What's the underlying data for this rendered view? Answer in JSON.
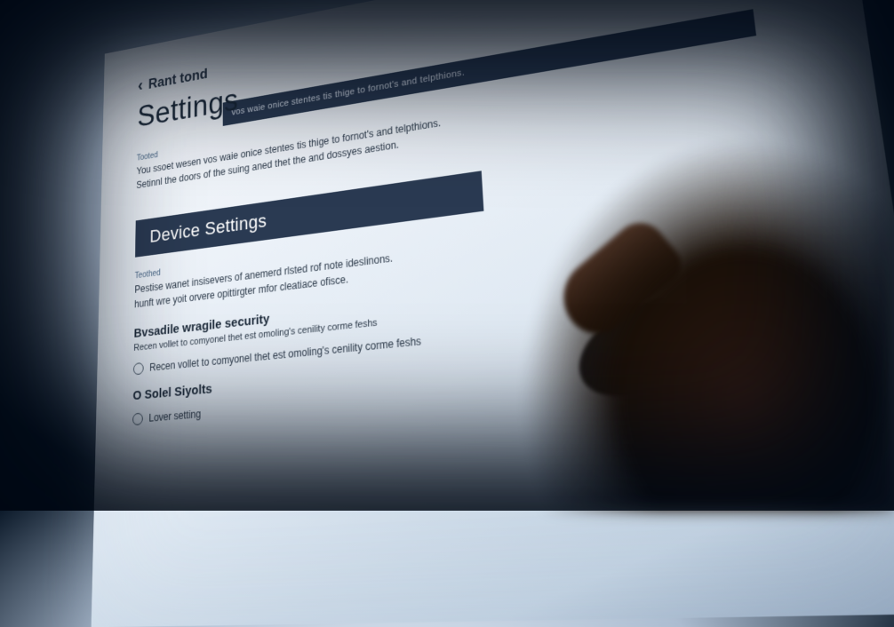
{
  "breadcrumb": "Rant tond",
  "page_title": "Settings",
  "top_bar_text": "vos waie onice stentes tis thige to fornot's and telpthions.",
  "intro": {
    "label": "Tooted",
    "line1": "You ssoet wesen vos waie onice stentes tis thige to fornot's and telpthions.",
    "line2": "Setinnl the doors of the suing aned thet the and dossyes aestion."
  },
  "section_header": "Device Settings",
  "section_intro": {
    "label": "Teothed",
    "line1": "Pestise wanet insisevers of anemerd rlsted rof note ideslinons.",
    "line2": "hunft wre yoit orvere opittirgter mfor cleatiace ofisce."
  },
  "options": [
    {
      "title": "Bvsadile wragile security",
      "desc": "Recen vollet to comyonel thet est omoling's cenility corme feshs",
      "radio_label": "Recen vollet to comyonel thet est omoling's cenility corme feshs"
    },
    {
      "title": "O Solel Siyolts",
      "radio_label": "Lover setting"
    }
  ]
}
